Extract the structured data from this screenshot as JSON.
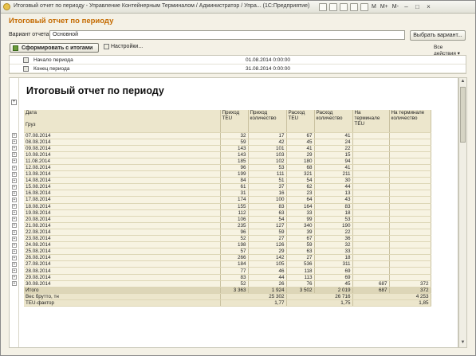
{
  "window": {
    "title": "Итоговый отчет по периоду - Управление Контейнерным Терминалом / Администратор / Упра...  (1С:Предприятие)",
    "memory_buttons": [
      "M",
      "M+",
      "M-"
    ]
  },
  "heading": "Итоговый отчет по периоду",
  "variant": {
    "label": "Вариант отчета:",
    "value": "Основной",
    "select_button": "Выбрать вариант..."
  },
  "toolbar": {
    "generate_label": "Сформировать с итогами",
    "settings_label": "Настройки...",
    "all_actions_label": "Все действия ▾"
  },
  "params": [
    {
      "label": "Начало периода",
      "value": "01.08.2014 0:00:00"
    },
    {
      "label": "Конец периода",
      "value": "31.08.2014 0:00:00"
    }
  ],
  "report": {
    "title": "Итоговый отчет по периоду",
    "group_header_1": "Дата",
    "group_header_2": "Груз",
    "columns": [
      "Приход TEU",
      "Приход количество",
      "Расход TEU",
      "Расход количество",
      "На терминале TEU",
      "На терминале количество"
    ],
    "rows": [
      {
        "date": "07.08.2014",
        "v": [
          "32",
          "17",
          "67",
          "41",
          "",
          ""
        ]
      },
      {
        "date": "08.08.2014",
        "v": [
          "59",
          "42",
          "45",
          "24",
          "",
          ""
        ]
      },
      {
        "date": "09.08.2014",
        "v": [
          "143",
          "101",
          "41",
          "22",
          "",
          ""
        ]
      },
      {
        "date": "10.08.2014",
        "v": [
          "143",
          "103",
          "29",
          "15",
          "",
          ""
        ]
      },
      {
        "date": "11.08.2014",
        "v": [
          "185",
          "102",
          "180",
          "94",
          "",
          ""
        ]
      },
      {
        "date": "12.08.2014",
        "v": [
          "96",
          "53",
          "68",
          "41",
          "",
          ""
        ]
      },
      {
        "date": "13.08.2014",
        "v": [
          "199",
          "111",
          "321",
          "211",
          "",
          ""
        ]
      },
      {
        "date": "14.08.2014",
        "v": [
          "84",
          "51",
          "54",
          "30",
          "",
          ""
        ]
      },
      {
        "date": "15.08.2014",
        "v": [
          "61",
          "37",
          "62",
          "44",
          "",
          ""
        ]
      },
      {
        "date": "16.08.2014",
        "v": [
          "31",
          "16",
          "23",
          "13",
          "",
          ""
        ]
      },
      {
        "date": "17.08.2014",
        "v": [
          "174",
          "100",
          "64",
          "43",
          "",
          ""
        ]
      },
      {
        "date": "18.08.2014",
        "v": [
          "155",
          "83",
          "164",
          "83",
          "",
          ""
        ]
      },
      {
        "date": "19.08.2014",
        "v": [
          "112",
          "63",
          "33",
          "18",
          "",
          ""
        ]
      },
      {
        "date": "20.08.2014",
        "v": [
          "106",
          "54",
          "99",
          "53",
          "",
          ""
        ]
      },
      {
        "date": "21.08.2014",
        "v": [
          "235",
          "127",
          "340",
          "190",
          "",
          ""
        ]
      },
      {
        "date": "22.08.2014",
        "v": [
          "96",
          "59",
          "39",
          "22",
          "",
          ""
        ]
      },
      {
        "date": "23.08.2014",
        "v": [
          "52",
          "27",
          "67",
          "36",
          "",
          ""
        ]
      },
      {
        "date": "24.08.2014",
        "v": [
          "198",
          "126",
          "59",
          "32",
          "",
          ""
        ]
      },
      {
        "date": "25.08.2014",
        "v": [
          "57",
          "29",
          "63",
          "33",
          "",
          ""
        ]
      },
      {
        "date": "26.08.2014",
        "v": [
          "266",
          "142",
          "27",
          "18",
          "",
          ""
        ]
      },
      {
        "date": "27.08.2014",
        "v": [
          "184",
          "105",
          "536",
          "311",
          "",
          ""
        ]
      },
      {
        "date": "28.08.2014",
        "v": [
          "77",
          "46",
          "118",
          "69",
          "",
          ""
        ]
      },
      {
        "date": "29.08.2014",
        "v": [
          "83",
          "44",
          "113",
          "69",
          "",
          ""
        ]
      },
      {
        "date": "30.08.2014",
        "v": [
          "52",
          "26",
          "76",
          "45",
          "687",
          "372"
        ]
      }
    ],
    "total": {
      "label": "Итого",
      "v": [
        "3 363",
        "1 924",
        "3 502",
        "2 019",
        "687",
        "372"
      ]
    },
    "gross_weight": {
      "label": "Вес брутто, тн",
      "v": [
        "25 302",
        "26 716",
        "4 253"
      ]
    },
    "teu_factor": {
      "label": "TEU-фактор",
      "v": [
        "1,77",
        "1,75",
        "1,85"
      ]
    }
  }
}
